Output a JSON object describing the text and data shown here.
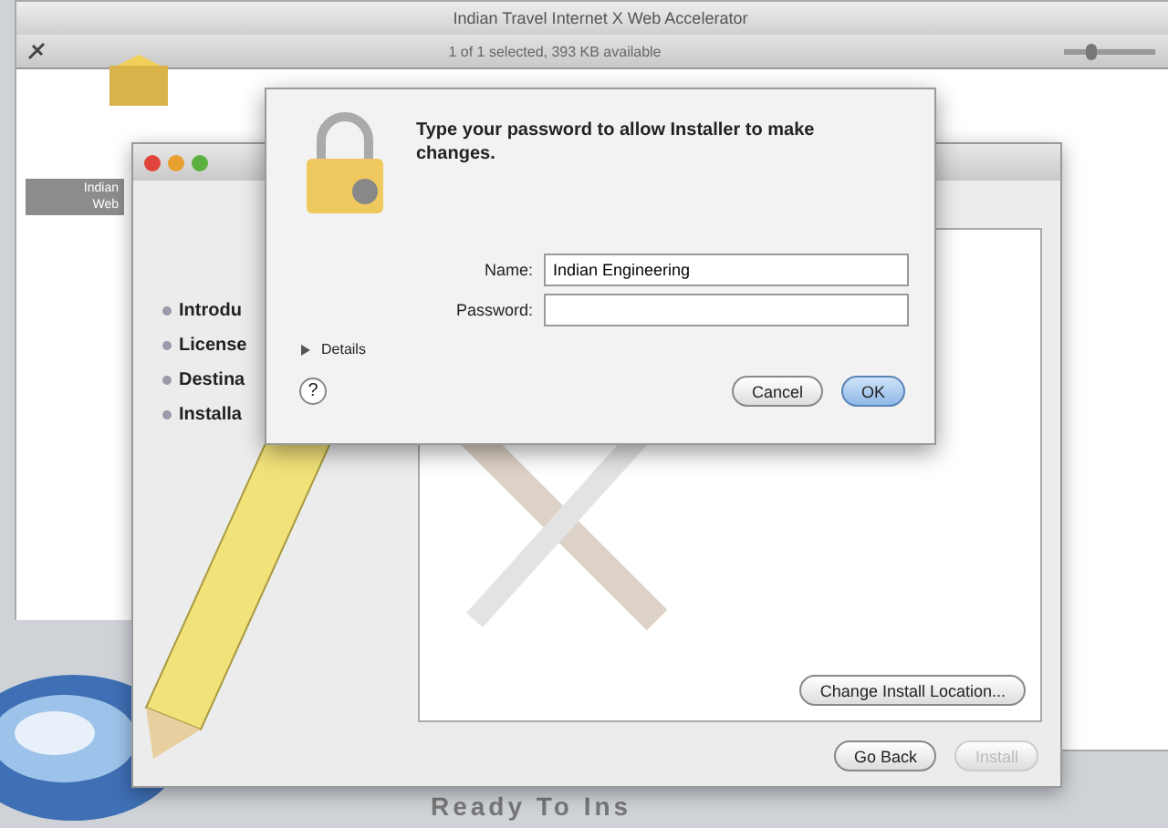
{
  "finder": {
    "title": "Indian Travel Internet X Web Accelerator",
    "status": "1 of 1 selected, 393 KB available",
    "icon_label": [
      "Indian",
      "Web"
    ],
    "caption": "Ready To Ins",
    "zoom_slider": {
      "level": 0.3
    }
  },
  "installer": {
    "steps": [
      {
        "label": "Introdu",
        "disabled": false
      },
      {
        "label": "License",
        "disabled": false
      },
      {
        "label": "Destina",
        "disabled": false
      },
      {
        "label": "Installa",
        "disabled": false
      }
    ],
    "change_button": {
      "label": "Change Install Location...",
      "disabled": false
    },
    "buttons": [
      {
        "label": "Go Back",
        "disabled": false
      },
      {
        "label": "Install",
        "disabled": true
      }
    ]
  },
  "dialog": {
    "message": "Type your password to allow Installer to make changes.",
    "name_label": "Name:",
    "name_value": "Indian Engineering",
    "password_label": "Password:",
    "details": {
      "label": "Details",
      "expanded": false
    },
    "help": "?",
    "buttons": [
      {
        "label": "Cancel",
        "default": false
      },
      {
        "label": "OK",
        "default": true
      }
    ]
  }
}
